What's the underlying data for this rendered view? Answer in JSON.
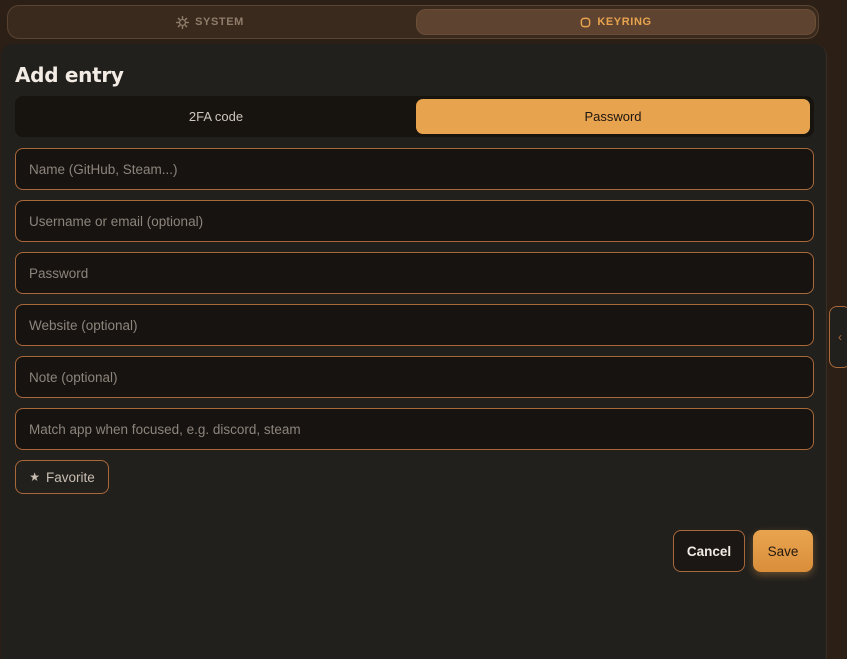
{
  "top_tabs": [
    {
      "label": "SYSTEM",
      "icon": "gear-icon"
    },
    {
      "label": "KEYRING",
      "icon": "ring-icon",
      "active": true
    }
  ],
  "form": {
    "title": "Add entry",
    "mode_tabs": [
      {
        "label": "2FA code"
      },
      {
        "label": "Password",
        "active": true
      }
    ],
    "fields": [
      {
        "placeholder": "Name (GitHub, Steam...)",
        "value": ""
      },
      {
        "placeholder": "Username or email (optional)",
        "value": ""
      },
      {
        "placeholder": "Password",
        "value": ""
      },
      {
        "placeholder": "Website (optional)",
        "value": ""
      },
      {
        "placeholder": "Note (optional)",
        "value": ""
      },
      {
        "placeholder": "Match app when focused, e.g. discord, steam",
        "value": ""
      }
    ],
    "favorite": {
      "icon": "star-icon",
      "label": "Favorite"
    },
    "cancel_label": "Cancel",
    "save_label": "Save"
  },
  "side_handle": {
    "icon": "chevron-left-icon"
  },
  "colors": {
    "accent": "#e8a34f",
    "border": "#a8683a",
    "panel": "#22201d",
    "background": "#2b1f16"
  }
}
